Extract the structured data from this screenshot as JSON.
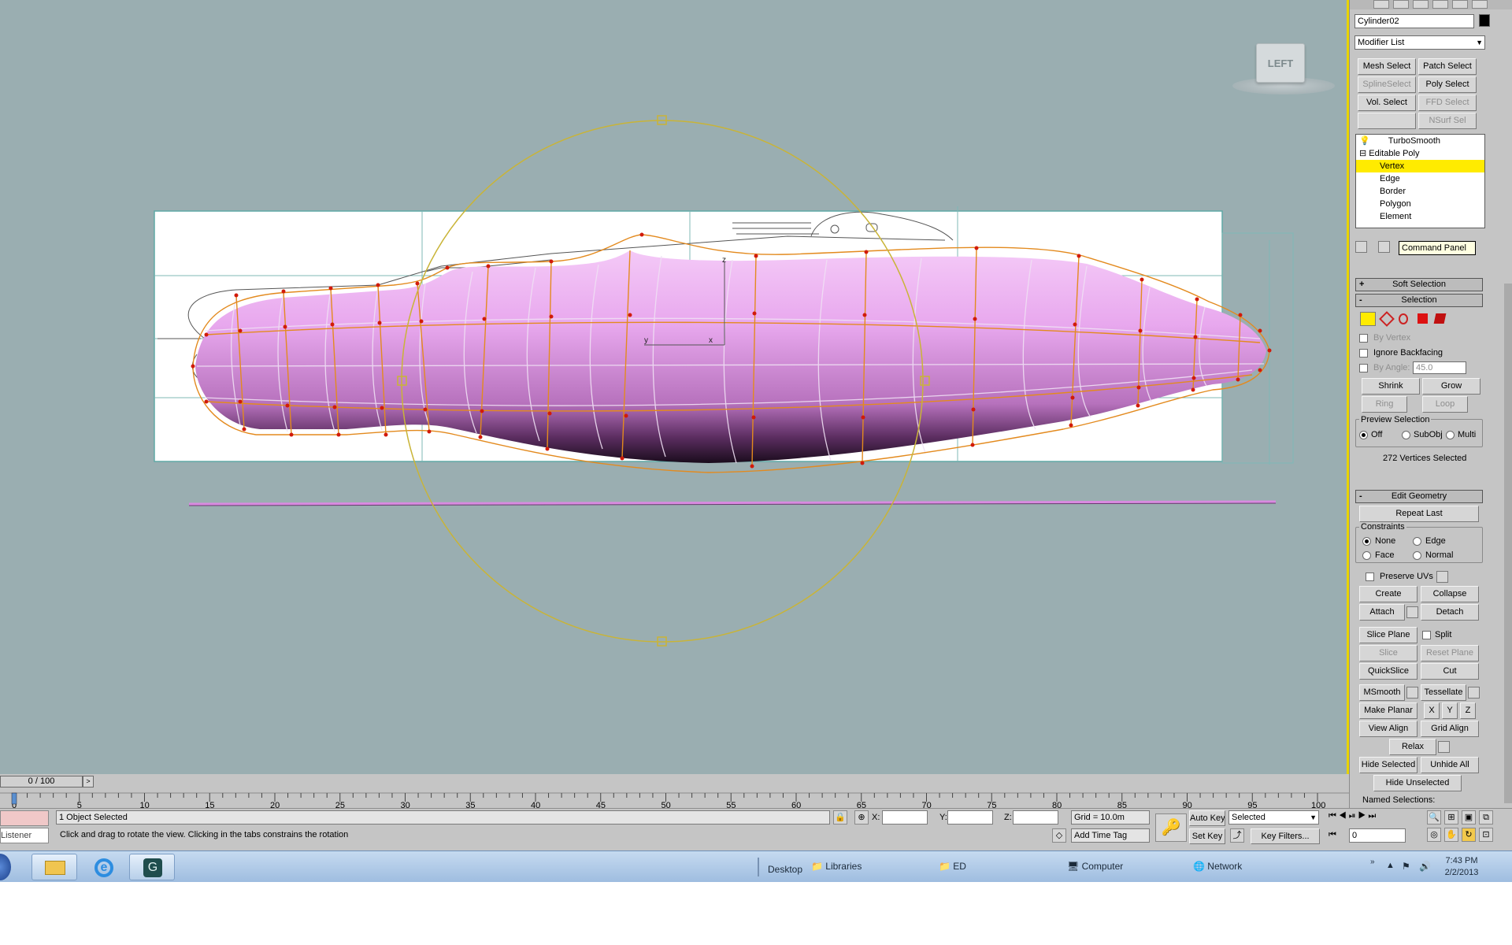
{
  "viewport": {
    "viewcube_label": "LEFT",
    "axis_labels": {
      "x": "x",
      "y": "y",
      "z": "z"
    }
  },
  "command_panel": {
    "object_name": "Cylinder02",
    "modifier_list": "Modifier List",
    "modifier_buttons": [
      "Mesh Select",
      "Patch Select",
      "SplineSelect",
      "Poly Select",
      "Vol. Select",
      "FFD Select",
      "",
      "NSurf Sel"
    ],
    "modifier_buttons_disabled": [
      false,
      false,
      true,
      false,
      false,
      true,
      false,
      true
    ],
    "stack": [
      "TurboSmooth",
      "Editable Poly",
      "Vertex",
      "Edge",
      "Border",
      "Polygon",
      "Element"
    ],
    "stack_selected": "Vertex",
    "tooltip": "Command Panel",
    "rollouts": {
      "soft_selection": "Soft Selection",
      "selection": "Selection",
      "edit_geometry": "Edit Geometry"
    },
    "selection": {
      "by_vertex": "By Vertex",
      "ignore_backfacing": "Ignore Backfacing",
      "by_angle": "By Angle:",
      "angle_value": "45.0",
      "shrink": "Shrink",
      "grow": "Grow",
      "ring": "Ring",
      "loop": "Loop",
      "preview_selection": "Preview Selection",
      "preview_options": [
        "Off",
        "SubObj",
        "Multi"
      ],
      "preview_selected": "Off",
      "status": "272 Vertices Selected"
    },
    "edit_geometry": {
      "repeat_last": "Repeat Last",
      "constraints": "Constraints",
      "constraint_options": [
        "None",
        "Edge",
        "Face",
        "Normal"
      ],
      "constraint_selected": "None",
      "preserve_uvs": "Preserve UVs",
      "create": "Create",
      "collapse": "Collapse",
      "attach": "Attach",
      "detach": "Detach",
      "slice_plane": "Slice Plane",
      "split": "Split",
      "slice": "Slice",
      "reset_plane": "Reset Plane",
      "quickslice": "QuickSlice",
      "cut": "Cut",
      "msmooth": "MSmooth",
      "tessellate": "Tessellate",
      "make_planar": "Make Planar",
      "x": "X",
      "y": "Y",
      "z": "Z",
      "view_align": "View Align",
      "grid_align": "Grid Align",
      "relax": "Relax",
      "hide_selected": "Hide Selected",
      "unhide_all": "Unhide All",
      "hide_unselected": "Hide Unselected",
      "named_selections": "Named Selections:"
    }
  },
  "timeline": {
    "frame_display": "0 / 100",
    "ticks": [
      0,
      5,
      10,
      15,
      20,
      25,
      30,
      35,
      40,
      45,
      50,
      55,
      60,
      65,
      70,
      75,
      80,
      85,
      90,
      95,
      100
    ]
  },
  "status": {
    "listener": "Listener",
    "selection_info": "1 Object Selected",
    "prompt": "Click and drag to rotate the view.  Clicking in the tabs constrains the rotation",
    "x_label": "X:",
    "y_label": "Y:",
    "z_label": "Z:",
    "grid": "Grid = 10.0m",
    "add_time_tag": "Add Time Tag",
    "auto_key": "Auto Key",
    "set_key": "Set Key",
    "key_mode": "Selected",
    "key_filters": "Key Filters...",
    "current_frame": "0"
  },
  "taskbar": {
    "toolbar_desktop": "Desktop",
    "libraries": "Libraries",
    "ed": "ED",
    "computer": "Computer",
    "network": "Network",
    "time": "7:43 PM",
    "date": "2/2/2013"
  },
  "colors": {
    "viewport_bg": "#9aaeb1",
    "mesh": "#e0a3e6",
    "wire": "#e38a1e",
    "vertex": "#d11a0a",
    "gizmo": "#c9b437",
    "stack_highlight": "#ffeb00",
    "selection_icon": "#ffeb00"
  }
}
